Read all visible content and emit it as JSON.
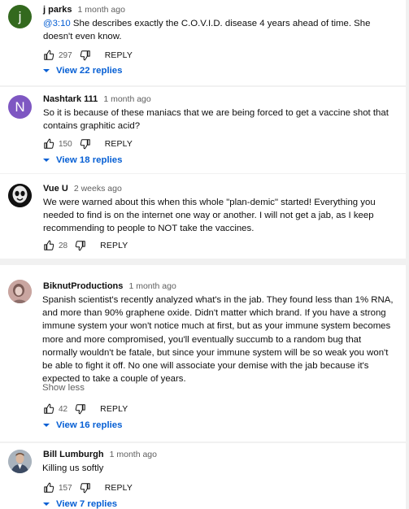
{
  "comments": [
    {
      "author": "j parks",
      "date": "1 month ago",
      "timestamp": "@3:10",
      "text": " She describes exactly the C.O.V.I.D. disease 4 years ahead of time.  She doesn't even know.",
      "likes": "297",
      "reply_label": "REPLY",
      "replies": "View 22 replies",
      "avatar_letter": "j",
      "avatar_color": "#33691e"
    },
    {
      "author": "Nashtark 111",
      "date": "1 month ago",
      "text": "So it is because of these maniacs that we are being forced to get a vaccine shot that contains graphitic acid?",
      "likes": "150",
      "reply_label": "REPLY",
      "replies": "View 18 replies",
      "avatar_letter": "N",
      "avatar_color": "#7e57c2"
    },
    {
      "author": "Vue U",
      "date": "2 weeks ago",
      "text": "We were warned about this when this whole \"plan-demic\" started! Everything you needed to find is on the internet one way or another. I will not get a jab, as I keep recommending to people to NOT take the vaccines.",
      "likes": "28",
      "reply_label": "REPLY"
    },
    {
      "author": "BiknutProductions",
      "date": "1 month ago",
      "text": "Spanish scientist's recently analyzed what's in the jab. They found less than 1% RNA, and more than 90% graphene oxide. Didn't matter which brand. If you have a strong immune system your won't notice much at first, but as your immune system becomes more and more compromised, you'll eventually succumb to a random bug that normally wouldn't be fatale, but since your immune system will be so weak you won't be able to fight it off. No one will associate your demise with the jab because it's expected to take a couple of years.",
      "show_less": "Show less",
      "likes": "42",
      "reply_label": "REPLY",
      "replies": "View 16 replies"
    },
    {
      "author": "Bill Lumburgh",
      "date": "1 month ago",
      "text": "Killing us softly",
      "likes": "157",
      "reply_label": "REPLY",
      "replies": "View 7 replies"
    }
  ],
  "colors": {
    "link_blue": "#065fd4",
    "secondary_text": "#606060",
    "background": "#f1f1f1"
  },
  "icons": {
    "like": "thumb-up-icon",
    "dislike": "thumb-down-icon",
    "expand": "chevron-down-icon"
  }
}
